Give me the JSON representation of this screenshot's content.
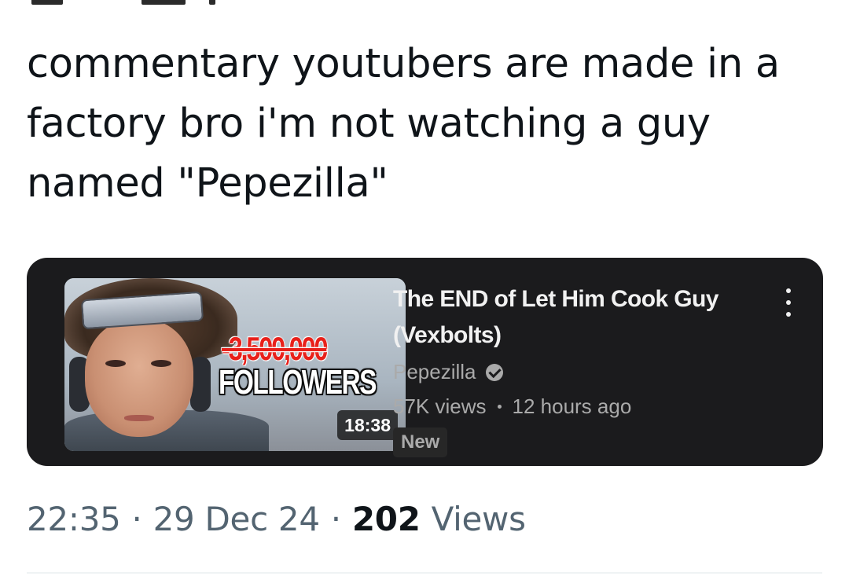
{
  "tweet": {
    "text": "commentary youtubers are made in a factory bro i'm not watching a guy named \"Pepezilla\""
  },
  "video_card": {
    "thumbnail": {
      "overlay_number": "-3,500,000",
      "overlay_word": "FOLLOWERS",
      "duration": "18:38"
    },
    "title": "The END of Let Him Cook Guy (Vexbolts)",
    "channel": "Pepezilla",
    "verified_icon": "verified-check-icon",
    "views": "57K views",
    "age": "12 hours ago",
    "badge": "New",
    "menu_icon": "more-vertical-icon"
  },
  "footer": {
    "time": "22:35",
    "date": "29 Dec 24",
    "views_count": "202",
    "views_label": "Views",
    "separator": "·"
  },
  "colors": {
    "card_bg": "#1b1b1d",
    "secondary_text": "#536471",
    "thumb_red": "#e8201a"
  }
}
